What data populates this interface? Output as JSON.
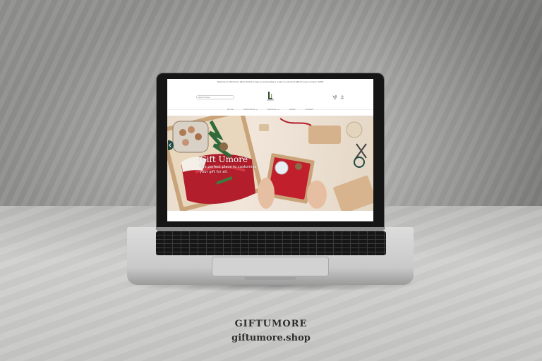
{
  "website": {
    "announcement": "Welcome to Gift Umore! We're thrilled to help you personalize & curate one-of-a-kind gifts for every occasion. SHOP",
    "search_placeholder": "Search here...",
    "logo_icon": "gift-umore-logo",
    "header_icons": [
      "cart-icon",
      "user-icon"
    ],
    "nav": [
      {
        "label": "Home"
      },
      {
        "label": "Collections"
      },
      {
        "label": "Services"
      },
      {
        "label": "About"
      },
      {
        "label": "Contact"
      }
    ],
    "hero": {
      "title": "Gift Umore",
      "subtitle": "The perfect place to customize your gift for all."
    }
  },
  "caption": {
    "brand": "GIFTUMORE",
    "url": "giftumore.shop"
  },
  "colors": {
    "accent": "#1e4a42",
    "gift_red": "#b21e2c"
  }
}
